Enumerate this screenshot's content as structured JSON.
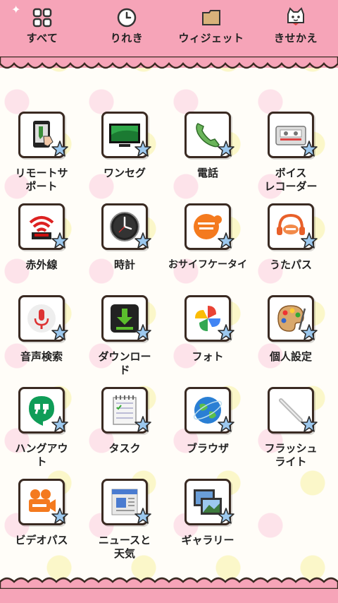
{
  "tabs": [
    {
      "label": "すべて",
      "icon": "grid-icon"
    },
    {
      "label": "りれき",
      "icon": "clock-icon"
    },
    {
      "label": "ウィジェット",
      "icon": "folder-icon"
    },
    {
      "label": "きせかえ",
      "icon": "cat-face-icon"
    }
  ],
  "apps": [
    {
      "label": "リモートサ\nポート",
      "icon": "remote-support-icon"
    },
    {
      "label": "ワンセグ",
      "icon": "tv-icon"
    },
    {
      "label": "電話",
      "icon": "phone-icon"
    },
    {
      "label": "ボイス\nレコーダー",
      "icon": "cassette-icon"
    },
    {
      "label": "赤外線",
      "icon": "infrared-icon"
    },
    {
      "label": "時計",
      "icon": "clock-app-icon"
    },
    {
      "label": "おサイフケータイ",
      "icon": "osaifu-icon"
    },
    {
      "label": "うたパス",
      "icon": "utapass-icon"
    },
    {
      "label": "音声検索",
      "icon": "microphone-icon"
    },
    {
      "label": "ダウンロー\nド",
      "icon": "download-icon"
    },
    {
      "label": "フォト",
      "icon": "pinwheel-icon"
    },
    {
      "label": "個人設定",
      "icon": "palette-icon"
    },
    {
      "label": "ハングアウ\nト",
      "icon": "hangouts-icon"
    },
    {
      "label": "タスク",
      "icon": "notepad-icon"
    },
    {
      "label": "ブラウザ",
      "icon": "globe-icon"
    },
    {
      "label": "フラッシュ\nライト",
      "icon": "flashlight-icon"
    },
    {
      "label": "ビデオパス",
      "icon": "videopass-icon"
    },
    {
      "label": "ニュースと\n天気",
      "icon": "news-icon"
    },
    {
      "label": "ギャラリー",
      "icon": "gallery-icon"
    }
  ],
  "colors": {
    "header_pink": "#f6a4b8",
    "frame_brown": "#3a2a22",
    "star_blue": "#8fc0e8"
  }
}
